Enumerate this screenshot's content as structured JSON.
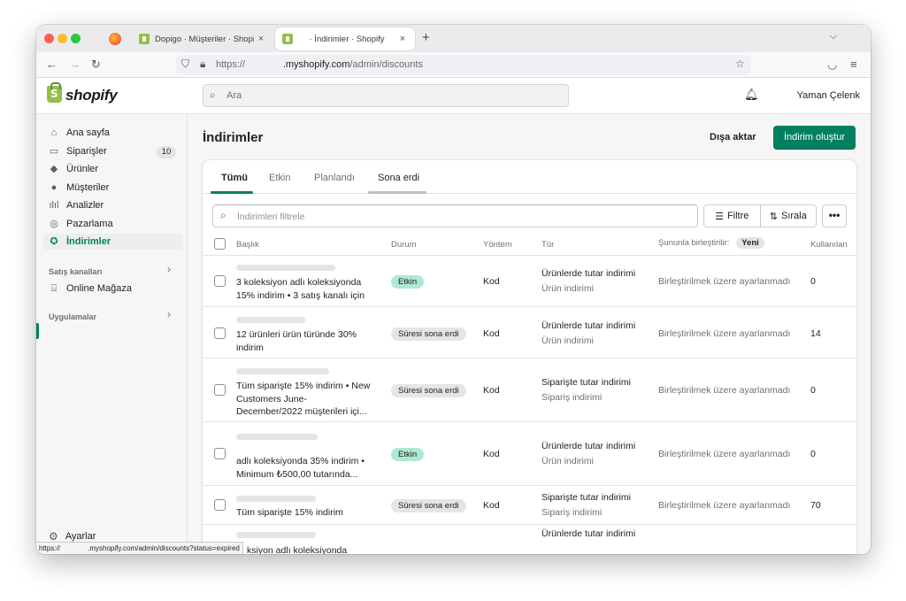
{
  "browser": {
    "tabs": [
      {
        "title": "Dopigo · Müşteriler · Shopify",
        "close": "×"
      },
      {
        "title": "· İndirimler · Shopify",
        "close": "×"
      }
    ],
    "new_tab": "+",
    "tab_menu": "⌵",
    "url_prefix": "https://",
    "url_domain": ".myshopify.com",
    "url_path": "/admin/discounts",
    "status_url": "https://              .myshopify.com/admin/discounts?status=expired"
  },
  "topbar": {
    "logo": "shopify",
    "search_placeholder": "Ara",
    "user_name": "Yaman Çelenk"
  },
  "sidebar": {
    "items": [
      {
        "label": "Ana sayfa",
        "icon": "home-icon"
      },
      {
        "label": "Siparişler",
        "icon": "orders-icon",
        "badge": "10"
      },
      {
        "label": "Ürünler",
        "icon": "tag-icon"
      },
      {
        "label": "Müşteriler",
        "icon": "person-icon"
      },
      {
        "label": "Analizler",
        "icon": "analytics-icon"
      },
      {
        "label": "Pazarlama",
        "icon": "marketing-icon"
      },
      {
        "label": "İndirimler",
        "icon": "discount-icon"
      }
    ],
    "sales_channels_title": "Satış kanalları",
    "online_store": "Online Mağaza",
    "apps_title": "Uygulamalar",
    "settings": "Ayarlar"
  },
  "main": {
    "title": "İndirimler",
    "export": "Dışa aktar",
    "create": "İndirim oluştur",
    "tabs": [
      "Tümü",
      "Etkin",
      "Planlandı",
      "Sona erdi"
    ],
    "filter_placeholder": "İndirimleri filtrele",
    "filter_btn": "Filtre",
    "sort_btn": "Sırala",
    "more_btn": "•••",
    "headers": {
      "title": "Başlık",
      "status": "Durum",
      "method": "Yöntem",
      "type": "Tür",
      "combine": "Şununla birleştirilir:",
      "new_badge": "Yeni",
      "usage": "Kullanılan"
    },
    "rows": [
      {
        "title": "3 koleksiyon adlı koleksiyonda 15% indirim • 3 satış kanalı için",
        "status": "Etkin",
        "method": "Kod",
        "type": "Ürünlerde tutar indirimi",
        "type_sub": "Ürün indirimi",
        "combine": "Birleştirilmek üzere ayarlanmadı",
        "usage": "0"
      },
      {
        "title": "12 ürünleri ürün türünde 30% indirim",
        "status": "Süresi sona erdi",
        "method": "Kod",
        "type": "Ürünlerde tutar indirimi",
        "type_sub": "Ürün indirimi",
        "combine": "Birleştirilmek üzere ayarlanmadı",
        "usage": "14"
      },
      {
        "title": "Tüm siparişte 15% indirim • New Customers June-December/2022 müşterileri içi...",
        "status": "Süresi sona erdi",
        "method": "Kod",
        "type": "Siparişte tutar indirimi",
        "type_sub": "Sipariş indirimi",
        "combine": "Birleştirilmek üzere ayarlanmadı",
        "usage": "0"
      },
      {
        "title": "adlı koleksiyonda 35% indirim • Minimum ₺500,00 tutarında...",
        "status": "Etkin",
        "method": "Kod",
        "type": "Ürünlerde tutar indirimi",
        "type_sub": "Ürün indirimi",
        "combine": "Birleştirilmek üzere ayarlanmadı",
        "usage": "0"
      },
      {
        "title": "Tüm siparişte 15% indirim",
        "status": "Süresi sona erdi",
        "method": "Kod",
        "type": "Siparişte tutar indirimi",
        "type_sub": "Sipariş indirimi",
        "combine": "Birleştirilmek üzere ayarlanmadı",
        "usage": "70"
      },
      {
        "title": "ksiyon adlı koleksiyonda",
        "type": "Ürünlerde tutar indirimi"
      }
    ]
  },
  "colors": {
    "brand_green": "#008060",
    "status_active": "#aee9d1",
    "status_expired": "#e4e5e7"
  }
}
